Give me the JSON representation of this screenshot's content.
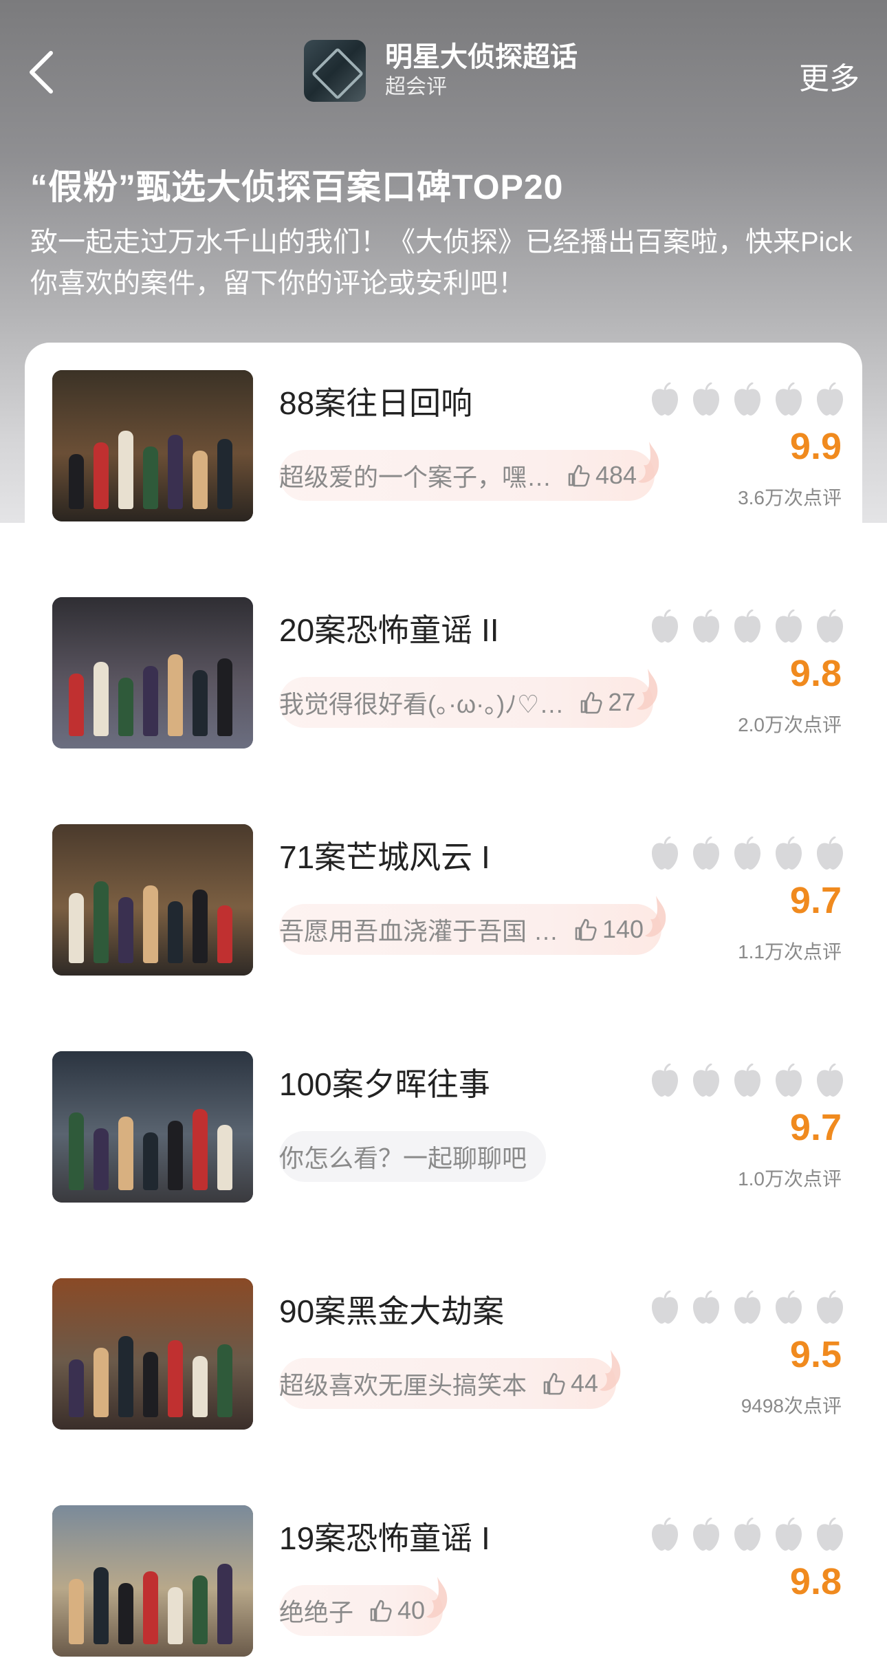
{
  "header": {
    "topic_title": "明星大侦探超话",
    "topic_subtitle": "超会评",
    "more_label": "更多"
  },
  "intro": {
    "title": "“假粉”甄选大侦探百案口碑TOP20",
    "description": "致一起走过万水千山的我们！《大侦探》已经播出百案啦，快来Pick你喜欢的案件，留下你的评论或安利吧！"
  },
  "colors": {
    "score": "#f08a1e",
    "muted_text": "#8a8a8a",
    "star_gray": "#d8d8da"
  },
  "items": [
    {
      "title": "88案往日回响",
      "comment": "超级爱的一个案子，嘿…",
      "likes": "484",
      "score": "9.9",
      "votes": "3.6万次点评"
    },
    {
      "title": "20案恐怖童谣 II",
      "comment": "我觉得很好看(。·ω·。)ﾉ♡…",
      "likes": "27",
      "score": "9.8",
      "votes": "2.0万次点评"
    },
    {
      "title": "71案芒城风云 I",
      "comment": "吾愿用吾血浇灌于吾国 …",
      "likes": "140",
      "score": "9.7",
      "votes": "1.1万次点评"
    },
    {
      "title": "100案夕晖往事",
      "comment": "你怎么看？一起聊聊吧",
      "likes": "",
      "score": "9.7",
      "votes": "1.0万次点评"
    },
    {
      "title": "90案黑金大劫案",
      "comment": "超级喜欢无厘头搞笑本",
      "likes": "44",
      "score": "9.5",
      "votes": "9498次点评"
    },
    {
      "title": "19案恐怖童谣 I",
      "comment": "绝绝子",
      "likes": "40",
      "score": "9.8",
      "votes": ""
    }
  ]
}
